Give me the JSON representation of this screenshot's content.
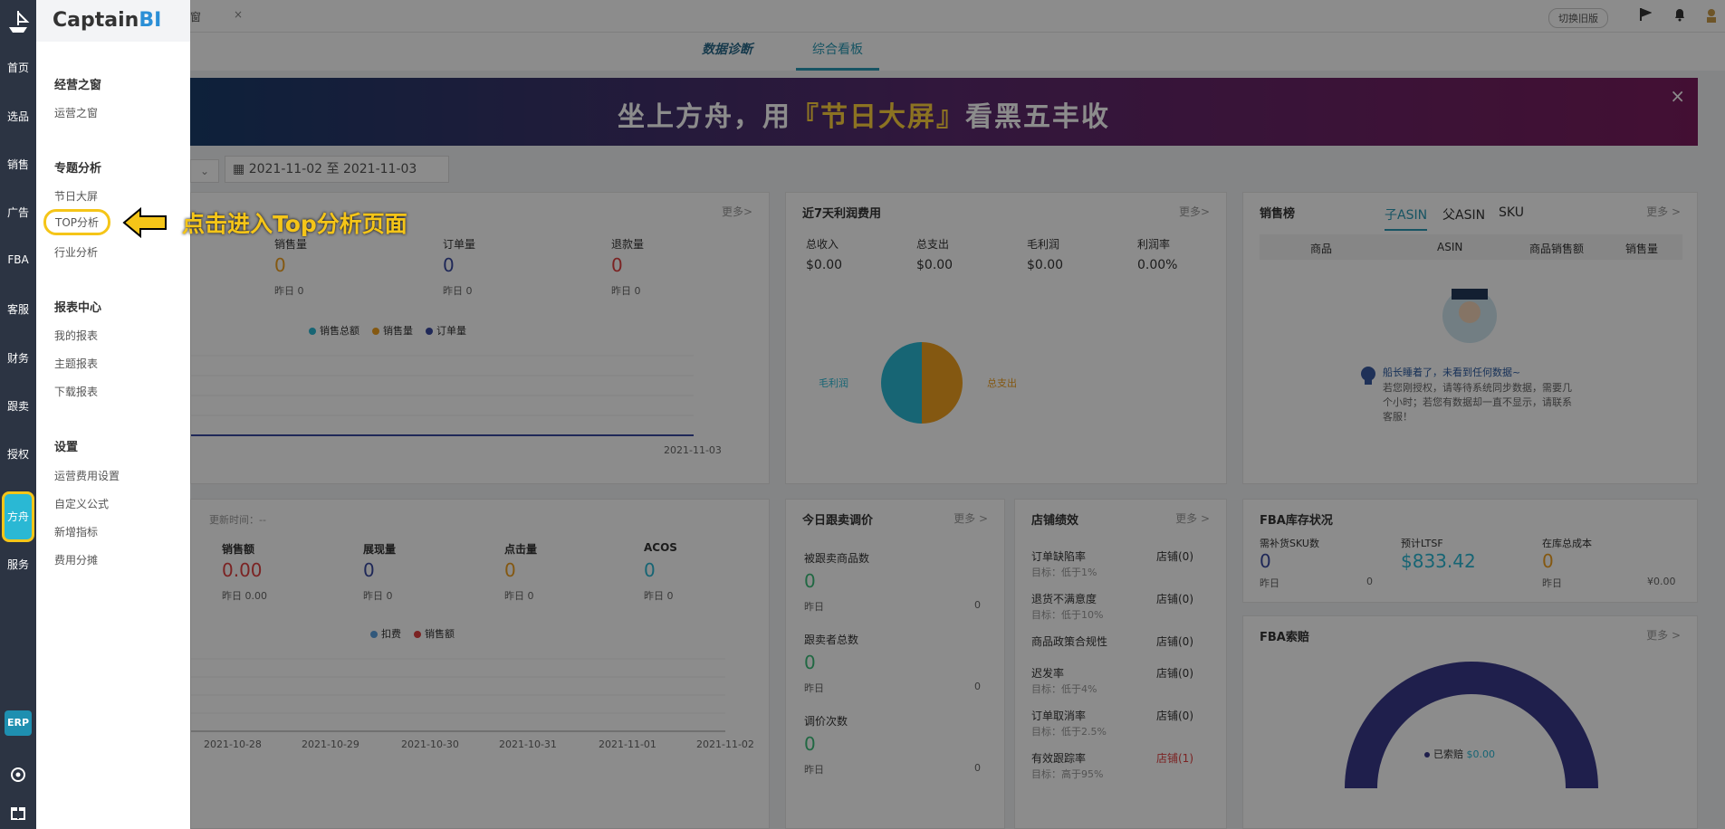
{
  "sidebar": {
    "items": [
      {
        "label": "首页"
      },
      {
        "label": "选品"
      },
      {
        "label": "销售"
      },
      {
        "label": "广告"
      },
      {
        "label": "FBA"
      },
      {
        "label": "客服"
      },
      {
        "label": "财务"
      },
      {
        "label": "跟卖"
      },
      {
        "label": "授权"
      },
      {
        "label": "方舟"
      },
      {
        "label": "服务"
      }
    ],
    "erp_label": "ERP"
  },
  "menu": {
    "brand_main": "Captain",
    "brand_accent": "BI",
    "sections": [
      {
        "title": "经营之窗",
        "items": [
          "运营之窗"
        ]
      },
      {
        "title": "专题分析",
        "items": [
          "节日大屏",
          "TOP分析",
          "行业分析"
        ]
      },
      {
        "title": "报表中心",
        "items": [
          "我的报表",
          "主题报表",
          "下载报表"
        ]
      },
      {
        "title": "设置",
        "items": [
          "运营费用设置",
          "自定义公式",
          "新增指标",
          "费用分摊"
        ]
      }
    ]
  },
  "annotation": {
    "text": "点击进入Top分析页面"
  },
  "topbar": {
    "tab_suffix": "窗",
    "old_version": "切换旧版"
  },
  "tabs": [
    {
      "label": "数据诊断"
    },
    {
      "label": "综合看板"
    }
  ],
  "banner": {
    "text_a": "坐上方舟，用",
    "text_b": "『节日大屏』",
    "text_c": "看黑五丰收"
  },
  "date_range": "2021-11-02 至 2021-11-03",
  "sales": {
    "more": "更多>",
    "metrics": [
      {
        "label": "销售量",
        "value": "0",
        "yesterday": "昨日  0"
      },
      {
        "label": "订单量",
        "value": "0",
        "yesterday": "昨日  0"
      },
      {
        "label": "退款量",
        "value": "0",
        "yesterday": "昨日  0"
      }
    ],
    "legend": [
      "销售总额",
      "销售量",
      "订单量"
    ],
    "x_label": "2021-11-03"
  },
  "profit": {
    "title": "近7天利润费用",
    "more": "更多>",
    "cols": [
      {
        "label": "总收入",
        "value": "$0.00"
      },
      {
        "label": "总支出",
        "value": "$0.00"
      },
      {
        "label": "毛利润",
        "value": "$0.00"
      },
      {
        "label": "利润率",
        "value": "0.00%"
      }
    ],
    "pie_left": "毛利润",
    "pie_right": "总支出"
  },
  "ranking": {
    "title": "销售榜",
    "tabs": [
      "子ASIN",
      "父ASIN",
      "SKU"
    ],
    "more": "更多 >",
    "cols": [
      "商品",
      "ASIN",
      "商品销售额",
      "销售量"
    ],
    "empty_title": "船长睡着了，未看到任何数据~",
    "empty_desc": "若您刚授权，请等待系统同步数据，需要几个小时；若您有数据却一直不显示，请联系客服！"
  },
  "ads": {
    "update": "更新时间：--",
    "metrics": [
      {
        "label": "销售额",
        "value": "0.00",
        "yesterday": "昨日  0.00"
      },
      {
        "label": "展现量",
        "value": "0",
        "yesterday": "昨日  0"
      },
      {
        "label": "点击量",
        "value": "0",
        "yesterday": "昨日  0"
      },
      {
        "label": "ACOS",
        "value": "0",
        "yesterday": "昨日  0"
      }
    ],
    "legend": [
      "扣费",
      "销售额"
    ],
    "x_labels": [
      "2021-10-28",
      "2021-10-29",
      "2021-10-30",
      "2021-10-31",
      "2021-11-01",
      "2021-11-02"
    ]
  },
  "follow": {
    "title": "今日跟卖调价",
    "more": "更多 >",
    "rows": [
      {
        "label": "被跟卖商品数",
        "value": "0",
        "yesterday": "昨日",
        "yvalue": "0"
      },
      {
        "label": "跟卖者总数",
        "value": "0",
        "yesterday": "昨日",
        "yvalue": "0"
      },
      {
        "label": "调价次数",
        "value": "0",
        "yesterday": "昨日",
        "yvalue": "0"
      }
    ]
  },
  "perf": {
    "title": "店铺绩效",
    "more": "更多 >",
    "rows": [
      {
        "label": "订单缺陷率",
        "target": "目标：低于1%",
        "value": "店铺(0)"
      },
      {
        "label": "退货不满意度",
        "target": "目标：低于10%",
        "value": "店铺(0)"
      },
      {
        "label": "商品政策合规性",
        "target": "",
        "value": "店铺(0)"
      },
      {
        "label": "迟发率",
        "target": "目标：低于4%",
        "value": "店铺(0)"
      },
      {
        "label": "订单取消率",
        "target": "目标：低于2.5%",
        "value": "店铺(0)"
      },
      {
        "label": "有效跟踪率",
        "target": "目标：高于95%",
        "value": "店铺(1)"
      }
    ]
  },
  "fba_stock": {
    "title": "FBA库存状况",
    "cols": [
      {
        "label": "需补货SKU数",
        "value": "0",
        "yesterday": "昨日",
        "yvalue": "0"
      },
      {
        "label": "预计LTSF",
        "value": "$833.42",
        "yesterday": "",
        "yvalue": ""
      },
      {
        "label": "在库总成本",
        "value": "0",
        "yesterday": "昨日",
        "yvalue": "¥0.00"
      }
    ]
  },
  "fba_claim": {
    "title": "FBA索赔",
    "more": "更多 >",
    "legend": "已索赔",
    "legend_value": "$0.00"
  }
}
